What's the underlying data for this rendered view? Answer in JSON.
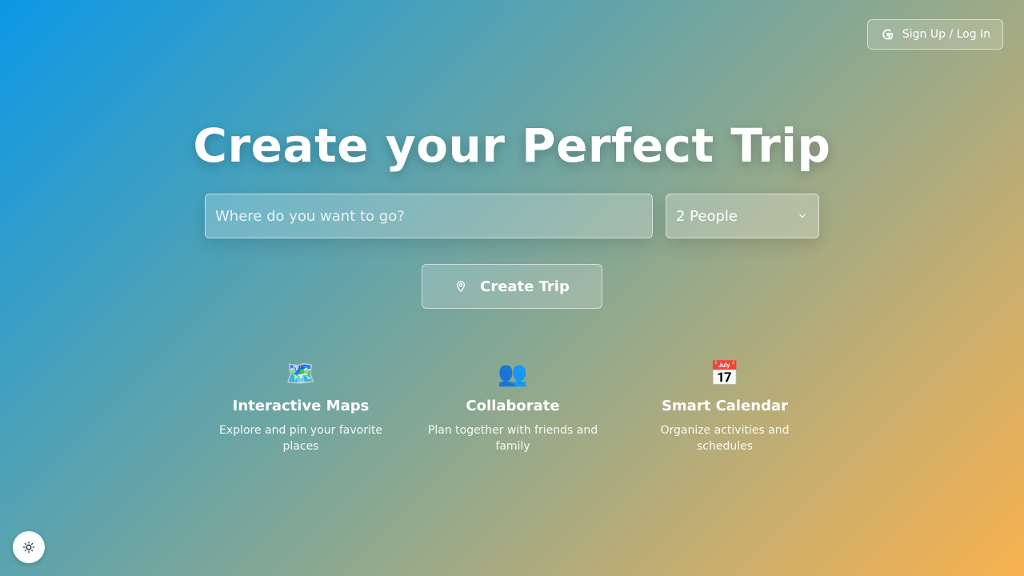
{
  "header": {
    "auth_label": "Sign Up / Log In",
    "auth_icon": "google-icon"
  },
  "hero": {
    "title": "Create your Perfect Trip"
  },
  "search": {
    "destination_placeholder": "Where do you want to go?",
    "destination_value": "",
    "people_selected": "2 People",
    "create_label": "Create Trip",
    "create_icon": "map-pin-icon"
  },
  "features": [
    {
      "icon": "world-map-icon",
      "emoji": "🗺️",
      "title": "Interactive Maps",
      "description": "Explore and pin your favorite places"
    },
    {
      "icon": "people-icon",
      "emoji": "👥",
      "title": "Collaborate",
      "description": "Plan together with friends and family"
    },
    {
      "icon": "calendar-icon",
      "emoji": "📅",
      "title": "Smart Calendar",
      "description": "Organize activities and schedules"
    }
  ],
  "theme_toggle": {
    "icon": "sun-icon"
  },
  "colors": {
    "gradient_start": "#0b98e6",
    "gradient_end": "#f7b24e",
    "text": "#ffffff"
  }
}
